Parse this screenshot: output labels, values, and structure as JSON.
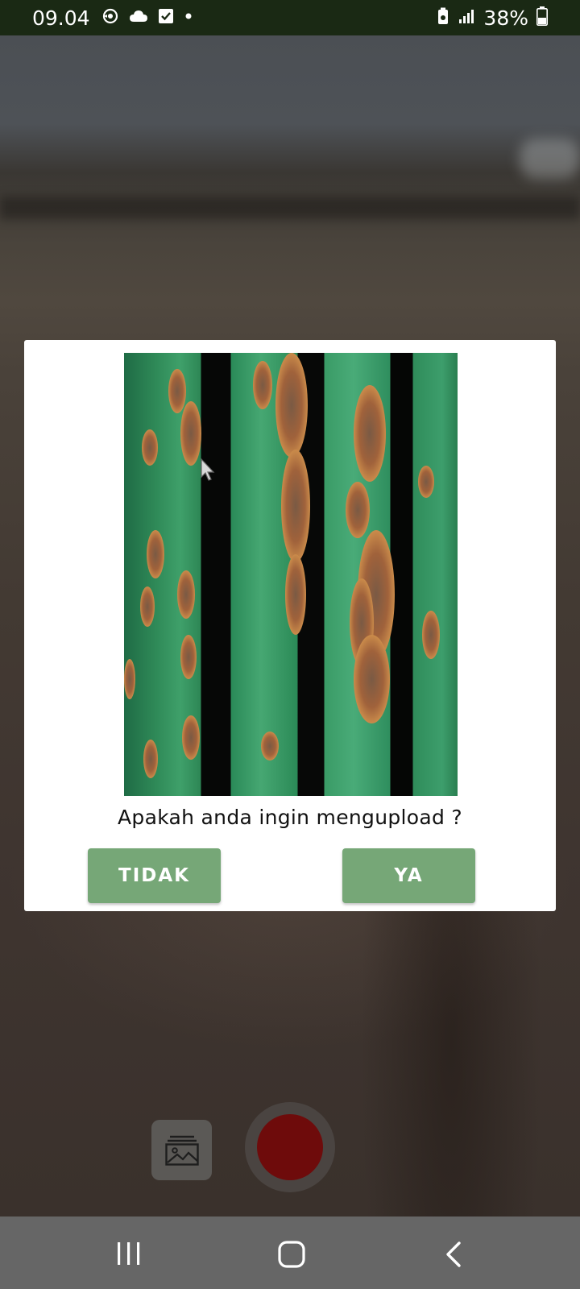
{
  "status_bar": {
    "time": "09.04",
    "left_icons": [
      "sync-icon",
      "cloud-icon",
      "checkbox-icon",
      "dot-icon"
    ],
    "right_icons": [
      "battery-saver-icon",
      "signal-icon"
    ],
    "battery_percent": "38%"
  },
  "dialog": {
    "image_description_icon": "rice-leaf-photo",
    "question": "Apakah anda ingin mengupload ?",
    "buttons": {
      "no": "TIDAK",
      "yes": "YA"
    },
    "button_color": "#76a777"
  },
  "camera_controls": {
    "gallery_icon": "gallery-icon",
    "shutter_color": "#6e0b0b"
  },
  "nav_bar": {
    "icons": [
      "recent-apps-icon",
      "home-icon",
      "back-icon"
    ]
  }
}
